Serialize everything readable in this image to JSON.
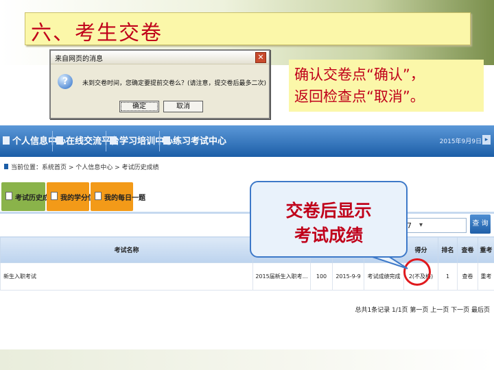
{
  "slide": {
    "title": "六、考生交卷",
    "instruction_line1": "确认交卷点“确认”，",
    "instruction_line2": "返回检查点“取消”。",
    "callout_line1": "交卷后显示",
    "callout_line2": "考试成绩"
  },
  "dialog": {
    "title": "来自网页的消息",
    "close": "✕",
    "icon": "question-icon",
    "message": "未到交卷时间，您确定要提前交卷么？(请注意，提交卷后最多二次)",
    "ok_label": "确定",
    "cancel_label": "取消"
  },
  "nav": {
    "items": [
      "个人信息中心",
      "在线交流平台",
      "学习培训中心",
      "练习考试中心"
    ],
    "date": "2015年9月9日",
    "arrow": "▸"
  },
  "breadcrumb": "当前位置：系统首页 > 个人信息中心 > 考试历史成绩",
  "subtabs": [
    "考试历史成绩",
    "我的学分信息",
    "我的每日一题"
  ],
  "filter": {
    "select_value": "7",
    "select_arrow": "▾",
    "query_label": "查 询"
  },
  "table": {
    "headers": [
      "考试名称",
      "",
      "",
      "",
      "",
      "得分",
      "排名",
      "查卷",
      "重考"
    ],
    "rows": [
      [
        "新生入职考试",
        "2015届新生入职考…",
        "100",
        "2015-9-9",
        "考试成绩完成",
        "2(不及格)",
        "1",
        "查卷",
        "重考"
      ]
    ]
  },
  "pager": "总共1条记录 1/1页  第一页  上一页  下一页  最后页",
  "colors": {
    "accent_red": "#c0001a",
    "nav_blue": "#1c5ea7",
    "tab_green": "#8ab34a",
    "tab_orange": "#f39a18",
    "note_yellow": "#fbf7a9"
  }
}
